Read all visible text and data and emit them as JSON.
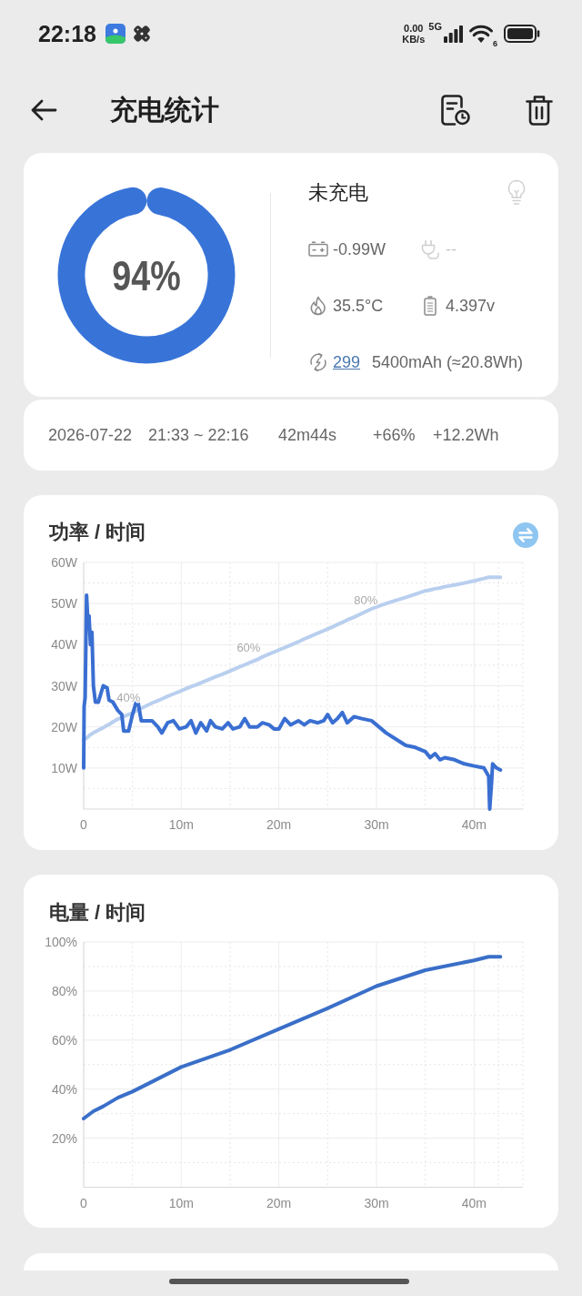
{
  "status_bar": {
    "time": "22:18",
    "network_speed": "0.00",
    "network_speed_unit": "KB/s",
    "network_type": "5G",
    "wifi_standard": "6"
  },
  "header": {
    "title": "充电统计"
  },
  "battery": {
    "level": 0.94,
    "percent": "94%",
    "status": "未充电",
    "power": "-0.99W",
    "charger_connected": false,
    "charger_power": "--",
    "temperature": "35.5°C",
    "voltage": "4.397v",
    "cycle_count": "299",
    "capacity": "5400mAh (≈20.8Wh)"
  },
  "session": {
    "date": "2026-07-22",
    "time_range": "21:33 ~ 22:16",
    "duration": "42m44s",
    "percent_gained": "+66%",
    "energy_gained": "+12.2Wh"
  },
  "power_chart": {
    "chart_data": {
      "type": "line",
      "title": "功率 / 时间",
      "grid": true,
      "x": [
        0,
        0.05,
        0.15,
        0.3,
        0.45,
        0.55,
        0.7,
        0.85,
        1,
        1.2,
        1.5,
        2,
        2.4,
        2.6,
        3,
        3.5,
        3.9,
        4.1,
        4.6,
        5,
        5.5,
        5.9,
        7,
        7.6,
        8,
        8.6,
        9.2,
        9.8,
        10.5,
        11,
        11.5,
        12,
        12.6,
        13,
        13.5,
        14.2,
        14.8,
        15.3,
        16,
        16.5,
        17,
        17.8,
        18.3,
        19,
        19.5,
        20,
        20.6,
        21.2,
        22,
        22.6,
        23.2,
        24,
        24.6,
        25,
        25.5,
        26,
        26.5,
        27,
        27.7,
        28.5,
        29.5,
        30,
        31,
        32,
        33,
        34,
        35,
        35.5,
        36,
        36.5,
        37,
        38,
        39,
        40,
        41,
        41.5,
        41.6,
        41.8,
        41.9,
        42.3,
        42.7
      ],
      "series": [
        {
          "color": "#3a6fd2",
          "values": [
            10,
            25,
            27,
            52,
            45,
            47,
            40,
            43,
            30,
            26,
            26,
            30,
            29.5,
            26.5,
            26,
            24,
            23,
            19,
            19,
            23,
            27,
            21.5,
            21.5,
            20,
            18.5,
            21,
            21.5,
            19.5,
            20,
            21.5,
            18.5,
            21,
            19,
            21.5,
            20,
            19.5,
            21,
            19.5,
            20,
            22,
            20,
            20,
            21,
            20.5,
            19.5,
            19.5,
            22,
            20.5,
            21.5,
            20.5,
            21.5,
            21,
            21.5,
            23,
            21,
            22,
            23.5,
            21,
            22.5,
            22,
            21.5,
            20.5,
            18.5,
            17,
            15.5,
            15,
            14,
            12.5,
            13.5,
            12,
            12.5,
            12,
            11,
            10.5,
            10,
            8,
            0,
            7,
            11,
            10,
            9.5
          ]
        },
        {
          "color": "#b9cfef",
          "values": [
            16.8,
            16.9,
            17.1,
            17.3,
            17.6,
            17.8,
            18.1,
            18.3,
            18.6,
            18.8,
            19.2,
            19.8,
            20.4,
            20.6,
            21.2,
            21.9,
            22.3,
            22.5,
            23,
            23.4,
            24,
            24.5,
            25.8,
            26.4,
            26.8,
            27.4,
            28,
            28.6,
            29.3,
            29.8,
            30.2,
            30.7,
            31.3,
            31.7,
            32.2,
            32.8,
            33.4,
            33.9,
            34.6,
            35.1,
            35.6,
            36.4,
            37,
            37.7,
            38.2,
            38.7,
            39.3,
            39.9,
            40.7,
            41.4,
            42,
            42.8,
            43.4,
            43.8,
            44.3,
            44.9,
            45.4,
            46,
            46.7,
            47.6,
            48.7,
            49.2,
            50,
            50.8,
            51.5,
            52.3,
            53.1,
            53.3,
            53.6,
            53.8,
            54.1,
            54.5,
            55,
            55.5,
            56.1,
            56.4,
            56.4,
            56.4,
            56.4,
            56.4,
            56.4
          ]
        }
      ],
      "xlim": [
        0,
        45
      ],
      "ylim": [
        0,
        60
      ],
      "xticks": [
        {
          "value": 0,
          "label": "0"
        },
        {
          "value": 10,
          "label": "10m"
        },
        {
          "value": 20,
          "label": "20m"
        },
        {
          "value": 30,
          "label": "30m"
        },
        {
          "value": 40,
          "label": "40m"
        }
      ],
      "yticks": [
        {
          "value": 10,
          "label": "10W"
        },
        {
          "value": 20,
          "label": "20W"
        },
        {
          "value": 30,
          "label": "30W"
        },
        {
          "value": 40,
          "label": "40W"
        },
        {
          "value": 50,
          "label": "50W"
        },
        {
          "value": 60,
          "label": "60W"
        }
      ],
      "annotations": [
        {
          "x": 4.6,
          "y": 25,
          "text": "40%"
        },
        {
          "x": 16.9,
          "y": 37,
          "text": "60%"
        },
        {
          "x": 28.9,
          "y": 48.6,
          "text": "80%"
        }
      ]
    }
  },
  "battery_chart": {
    "chart_data": {
      "type": "line",
      "title": "电量 / 时间",
      "grid": true,
      "x": [
        0,
        1,
        2,
        3.5,
        5,
        7,
        10,
        15,
        20,
        25,
        30,
        35,
        40,
        41.5,
        42.7
      ],
      "series": [
        {
          "color": "#3a6fc8",
          "values": [
            28,
            31,
            33,
            36.5,
            39,
            43,
            49,
            56,
            64.5,
            73,
            82,
            88.5,
            92.5,
            94,
            94
          ]
        }
      ],
      "xlim": [
        0,
        45
      ],
      "ylim": [
        0,
        100
      ],
      "xticks": [
        {
          "value": 0,
          "label": "0"
        },
        {
          "value": 10,
          "label": "10m"
        },
        {
          "value": 20,
          "label": "20m"
        },
        {
          "value": 30,
          "label": "30m"
        },
        {
          "value": 40,
          "label": "40m"
        }
      ],
      "yticks": [
        {
          "value": 20,
          "label": "20%"
        },
        {
          "value": 40,
          "label": "40%"
        },
        {
          "value": 60,
          "label": "60%"
        },
        {
          "value": 80,
          "label": "80%"
        },
        {
          "value": 100,
          "label": "100%"
        }
      ]
    }
  }
}
